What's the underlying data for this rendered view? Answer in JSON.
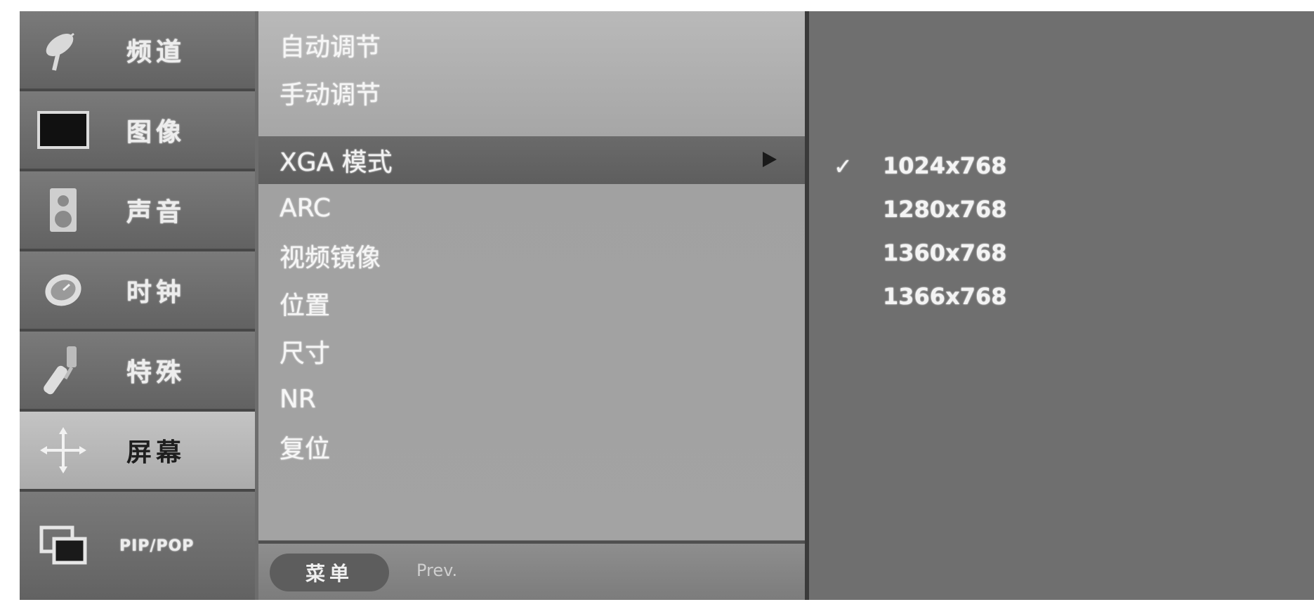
{
  "categories": [
    {
      "label": "频道",
      "icon": "satellite-dish-icon",
      "active": false
    },
    {
      "label": "图像",
      "icon": "screen-icon",
      "active": false
    },
    {
      "label": "声音",
      "icon": "speaker-icon",
      "active": false
    },
    {
      "label": "时钟",
      "icon": "clock-icon",
      "active": false
    },
    {
      "label": "特殊",
      "icon": "tools-icon",
      "active": false
    },
    {
      "label": "屏幕",
      "icon": "move-arrows-icon",
      "active": true
    },
    {
      "label": "PIP/POP",
      "icon": "pip-icon",
      "active": false
    }
  ],
  "options": [
    {
      "label": "自动调节",
      "selected": false
    },
    {
      "label": "手动调节",
      "selected": false
    },
    {
      "label": "XGA 模式",
      "selected": true
    },
    {
      "label": "ARC",
      "selected": false
    },
    {
      "label": "视频镜像",
      "selected": false
    },
    {
      "label": "位置",
      "selected": false
    },
    {
      "label": "尺寸",
      "selected": false
    },
    {
      "label": "NR",
      "selected": false
    },
    {
      "label": "复位",
      "selected": false
    }
  ],
  "footer": {
    "menu_label": "菜单",
    "hint": "Prev."
  },
  "resolutions": [
    {
      "label": "1024x768",
      "checked": true
    },
    {
      "label": "1280x768",
      "checked": false
    },
    {
      "label": "1360x768",
      "checked": false
    },
    {
      "label": "1366x768",
      "checked": false
    }
  ],
  "check_symbol": "✓",
  "colors": {
    "panel_bg": "#6d6d6d",
    "options_bg": "#a8a8a8",
    "selected_bar": "#626262",
    "active_category": "#b8b8b8"
  }
}
